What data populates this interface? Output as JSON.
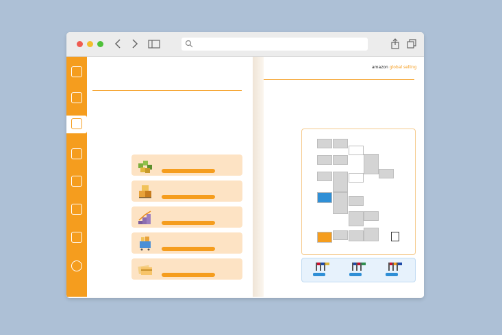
{
  "browser": {
    "window_controls": [
      "close",
      "minimize",
      "maximize"
    ],
    "nav_icons": [
      "chevron-left-icon",
      "chevron-right-icon",
      "sidebar-icon"
    ],
    "action_icons": [
      "share-icon",
      "tabs-icon"
    ],
    "search_icon": "search-icon"
  },
  "colors": {
    "accent": "#f59d1e",
    "blue": "#2f8fd6",
    "background": "#adc0d6"
  },
  "left_page": {
    "sidenav": [
      {
        "label": "",
        "icon": "home-icon"
      },
      {
        "label": "",
        "icon": "book-icon"
      },
      {
        "label": "",
        "icon": "document-icon",
        "active": true
      },
      {
        "label": "",
        "icon": "list-icon"
      },
      {
        "label": "",
        "icon": "chart-icon"
      },
      {
        "label": "",
        "icon": "grid-icon"
      },
      {
        "label": "",
        "icon": "cart-icon"
      },
      {
        "label": "",
        "icon": "globe-icon"
      }
    ],
    "breadcrumb": "",
    "breadcrumb_sub": "",
    "title": "",
    "sublabel": "",
    "paragraphs": [],
    "options_heading": "",
    "cards": [
      {
        "title": "",
        "desc": "",
        "button": "",
        "art": "blocks-art"
      },
      {
        "title": "",
        "desc": "",
        "button": "",
        "art": "boxes-art"
      },
      {
        "title": "",
        "desc": "",
        "button": "",
        "art": "stairs-art"
      },
      {
        "title": "",
        "desc": "",
        "button": "",
        "art": "cart-art"
      },
      {
        "title": "",
        "desc": "",
        "button": "",
        "art": "cards-art"
      }
    ]
  },
  "right_page": {
    "logo": {
      "brand": "amazon",
      "suffix": "global selling"
    },
    "heading": "",
    "paragraph": "",
    "diagram_title": "",
    "bottom_cards": [
      {
        "label": "",
        "button": ""
      },
      {
        "label": "",
        "button": ""
      },
      {
        "label": "",
        "button": ""
      }
    ],
    "copyright": ""
  }
}
